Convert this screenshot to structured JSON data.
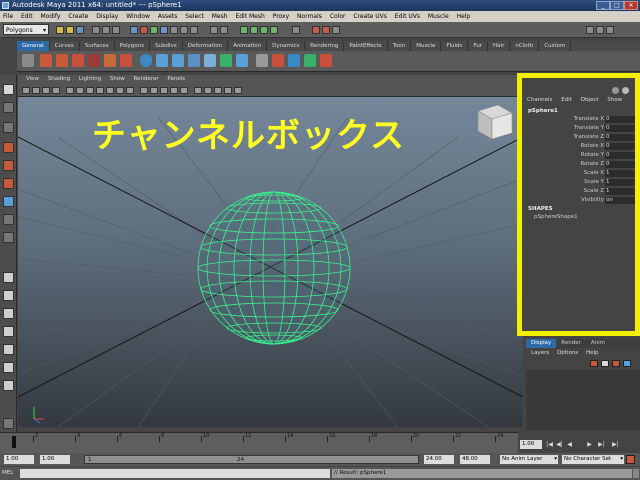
{
  "window": {
    "title": "Autodesk Maya 2011 x64: untitled*   ---   pSphere1",
    "minimize": "_",
    "maximize": "□",
    "close": "✕"
  },
  "menubar": [
    "File",
    "Edit",
    "Modify",
    "Create",
    "Display",
    "Window",
    "Assets",
    "Select",
    "Mesh",
    "Edit Mesh",
    "Proxy",
    "Normals",
    "Color",
    "Create UVs",
    "Edit UVs",
    "Muscle",
    "Help"
  ],
  "statusline": {
    "menu_set": "Polygons"
  },
  "shelf": {
    "tabs": [
      "General",
      "Curves",
      "Surfaces",
      "Polygons",
      "Subdivs",
      "Deformation",
      "Animation",
      "Dynamics",
      "Rendering",
      "PaintEffects",
      "Toon",
      "Muscle",
      "Fluids",
      "Fur",
      "Hair",
      "nCloth",
      "Custom"
    ],
    "active_tab": "General"
  },
  "panel": {
    "menu": [
      "View",
      "Shading",
      "Lighting",
      "Show",
      "Renderer",
      "Panels"
    ]
  },
  "overlay_label": "チャンネルボックス",
  "channel_box": {
    "menu": [
      "Channels",
      "Edit",
      "Object",
      "Show"
    ],
    "object_name": "pSphere1",
    "attributes": [
      {
        "name": "Translate X",
        "value": "0"
      },
      {
        "name": "Translate Y",
        "value": "0"
      },
      {
        "name": "Translate Z",
        "value": "0"
      },
      {
        "name": "Rotate X",
        "value": "0"
      },
      {
        "name": "Rotate Y",
        "value": "0"
      },
      {
        "name": "Rotate Z",
        "value": "0"
      },
      {
        "name": "Scale X",
        "value": "1"
      },
      {
        "name": "Scale Y",
        "value": "1"
      },
      {
        "name": "Scale Z",
        "value": "1"
      },
      {
        "name": "Visibility",
        "value": "on"
      }
    ],
    "shapes_header": "SHAPES",
    "shape_name": "pSphereShape1",
    "highlight_color": "#f2f000"
  },
  "layer_editor": {
    "tabs": [
      "Display",
      "Render",
      "Anim"
    ],
    "active_tab": "Display",
    "menu": [
      "Layers",
      "Options",
      "Help"
    ]
  },
  "time_slider": {
    "ticks": [
      "1",
      "2",
      "4",
      "6",
      "8",
      "10",
      "12",
      "14",
      "16",
      "18",
      "20",
      "22",
      "24"
    ],
    "current_frame": "1.00",
    "buttons": [
      "|◀",
      "◀|",
      "◀",
      "▶",
      "▶|",
      "▶|"
    ]
  },
  "range_slider": {
    "start": "1.00",
    "playback_start": "1.00",
    "slider_start": "1",
    "slider_end": "24",
    "playback_end": "24.00",
    "end": "48.00",
    "anim_layer": "No Anim Layer",
    "character_set": "No Character Set"
  },
  "command_line": {
    "language": "MEL",
    "result": "// Result: pSphere1"
  },
  "colors": {
    "wireframe": "#3cf08c",
    "overlay_text": "#ffff22",
    "active_tab": "#2f6aa8"
  }
}
